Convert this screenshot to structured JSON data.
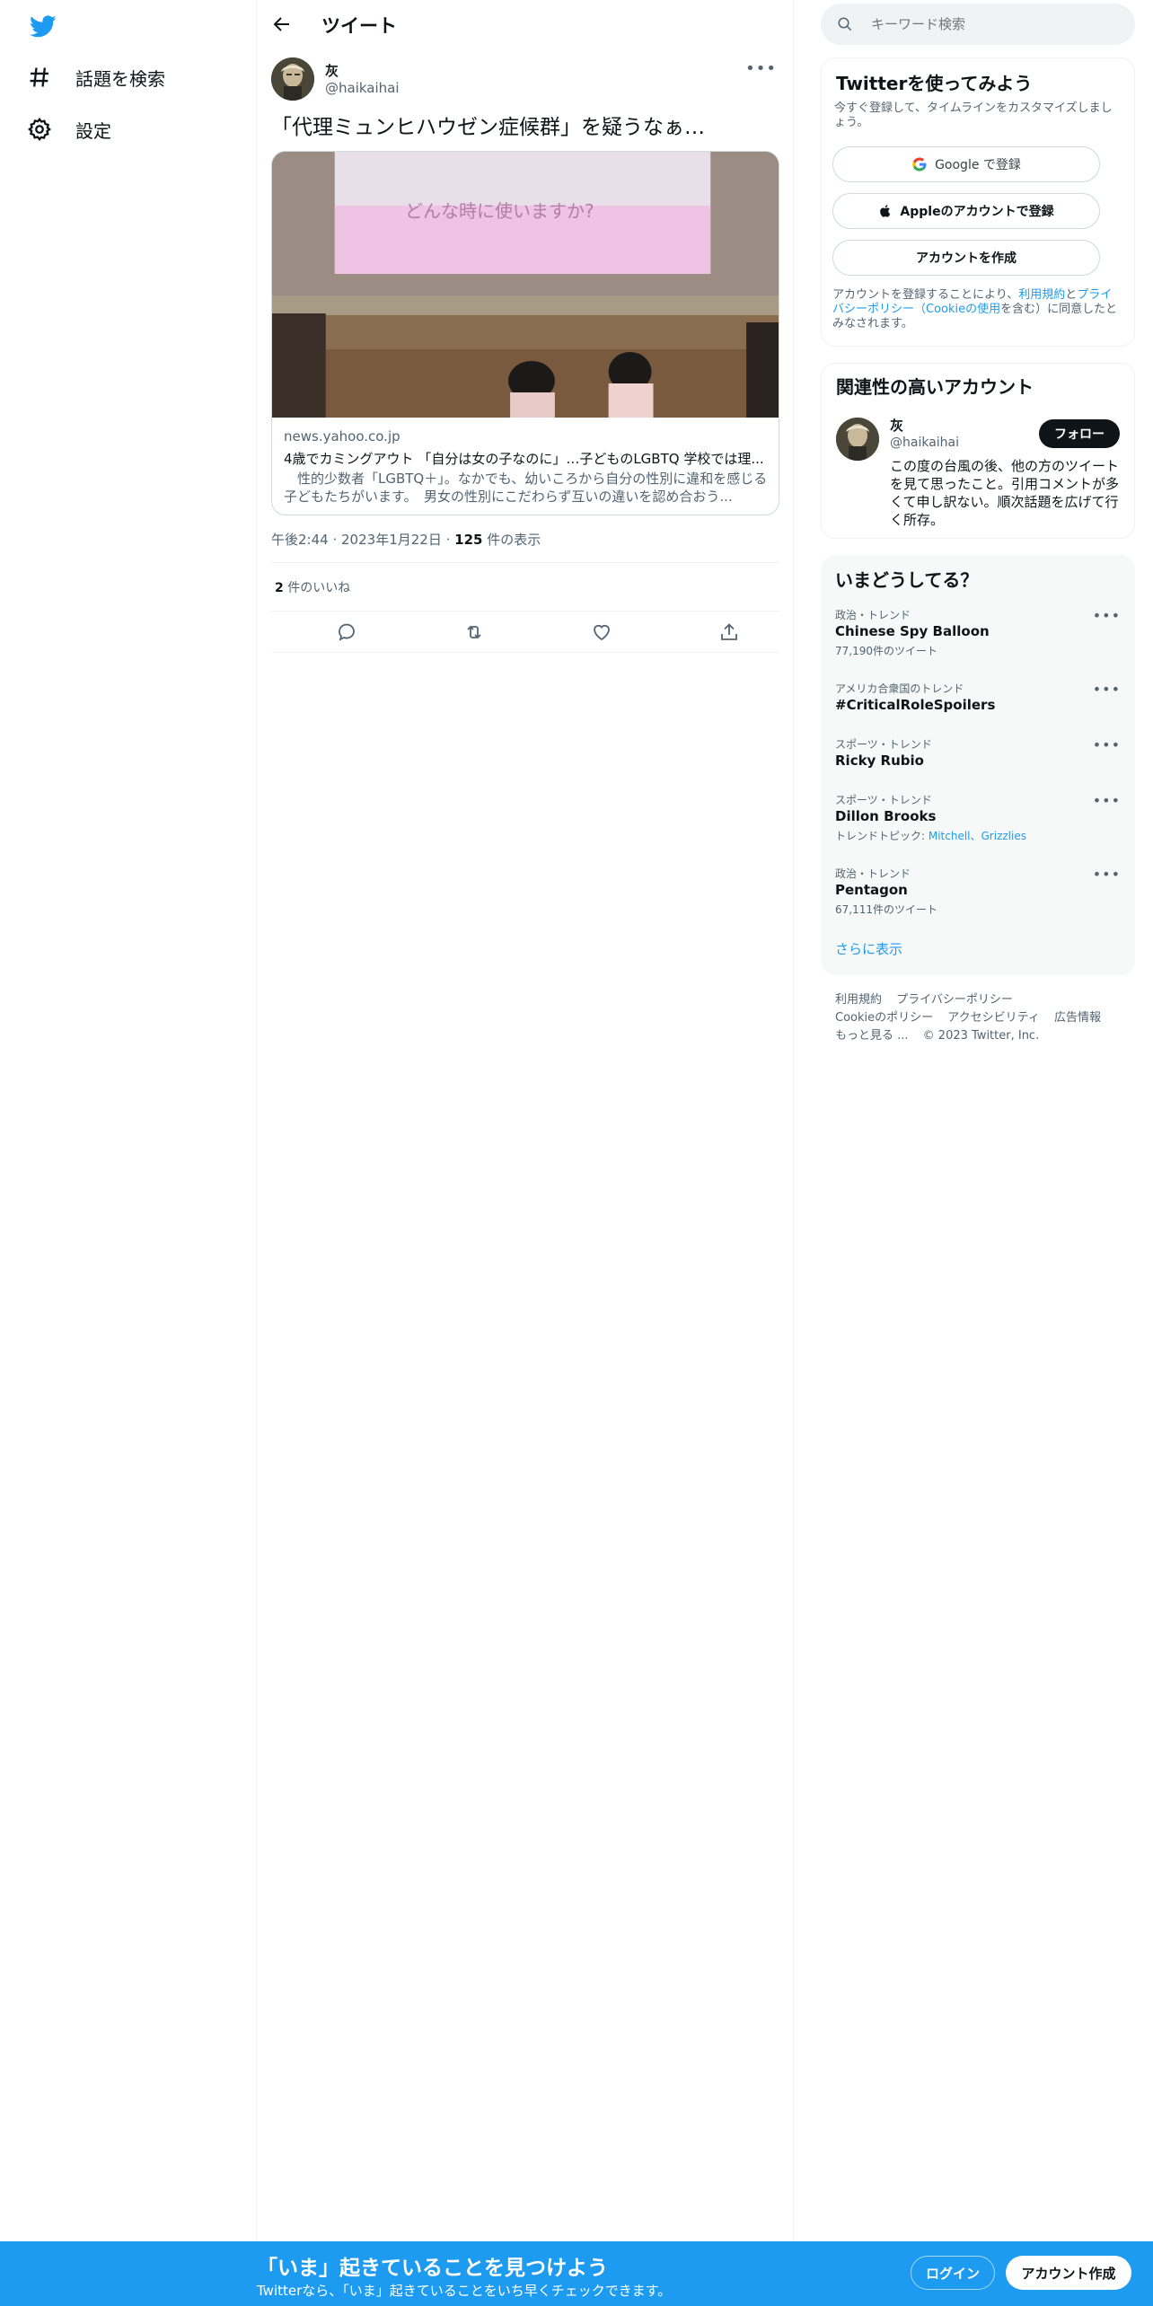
{
  "nav": {
    "logo_icon": "twitter-bird-icon",
    "items": [
      {
        "label": "話題を検索",
        "icon": "hashtag-icon"
      },
      {
        "label": "設定",
        "icon": "gear-icon"
      }
    ]
  },
  "header": {
    "title": "ツイート"
  },
  "tweet": {
    "author_name": "灰",
    "author_handle": "@haikaihai",
    "text": "「代理ミュンヒハウゼン症候群」を疑うなぁ…",
    "card": {
      "domain": "news.yahoo.co.jp",
      "title": "4歳でカミングアウト 「自分は女の子なのに」…子どものLGBTQ 学校では理...",
      "description": "　性的少数者「LGBTQ＋」。なかでも、幼いころから自分の性別に違和を感じる子どもたちがいます。　男女の性別にこだわらず互いの違いを認め合おう...",
      "slide_text": "どんな時に使いますか?"
    },
    "time": "午後2:44",
    "date": "2023年1月22日",
    "views_count": "125",
    "views_label": "件の表示",
    "likes_count": "2",
    "likes_label": "件のいいね"
  },
  "search": {
    "placeholder": "キーワード検索"
  },
  "signup": {
    "title": "Twitterを使ってみよう",
    "subtitle": "今すぐ登録して、タイムラインをカスタマイズしましょう。",
    "google_label": "Google で登録",
    "apple_label": "Appleのアカウントで登録",
    "create_label": "アカウントを作成",
    "legal_prefix": "アカウントを登録することにより、",
    "legal_terms": "利用規約",
    "legal_and": "と",
    "legal_privacy": "プライバシーポリシー",
    "legal_paren_open": "（",
    "legal_cookie": "Cookieの使用",
    "legal_suffix": "を含む）に同意したとみなされます。"
  },
  "related": {
    "title": "関連性の高いアカウント",
    "name": "灰",
    "handle": "@haikaihai",
    "follow_label": "フォロー",
    "bio": "この度の台風の後、他の方のツイートを見て思ったこと。引用コメントが多くて申し訳ない。順次話題を広げて行く所存。"
  },
  "trends": {
    "title": "いまどうしてる？",
    "items": [
      {
        "category": "政治・トレンド",
        "name": "Chinese Spy Balloon",
        "count": "77,190件のツイート"
      },
      {
        "category": "アメリカ合衆国のトレンド",
        "name": "#CriticalRoleSpoilers",
        "count": ""
      },
      {
        "category": "スポーツ・トレンド",
        "name": "Ricky Rubio",
        "count": ""
      },
      {
        "category": "スポーツ・トレンド",
        "name": "Dillon Brooks",
        "count_prefix": "トレンドトピック: ",
        "count_links": "Mitchell、Grizzlies"
      },
      {
        "category": "政治・トレンド",
        "name": "Pentagon",
        "count": "67,111件のツイート"
      }
    ],
    "show_more": "さらに表示"
  },
  "footer": {
    "terms": "利用規約",
    "privacy": "プライバシーポリシー",
    "cookie": "Cookieのポリシー",
    "accessibility": "アクセシビリティ",
    "ads": "広告情報",
    "more": "もっと見る ...",
    "copyright": "© 2023 Twitter, Inc."
  },
  "bottom_bar": {
    "title": "「いま」起きていることを見つけよう",
    "subtitle": "Twitterなら、「いま」起きていることをいち早くチェックできます。",
    "login_label": "ログイン",
    "signup_label": "アカウント作成"
  },
  "colors": {
    "accent": "#1d9bf0",
    "text": "#0f1419",
    "secondary": "#536471",
    "border": "#eff3f4"
  }
}
